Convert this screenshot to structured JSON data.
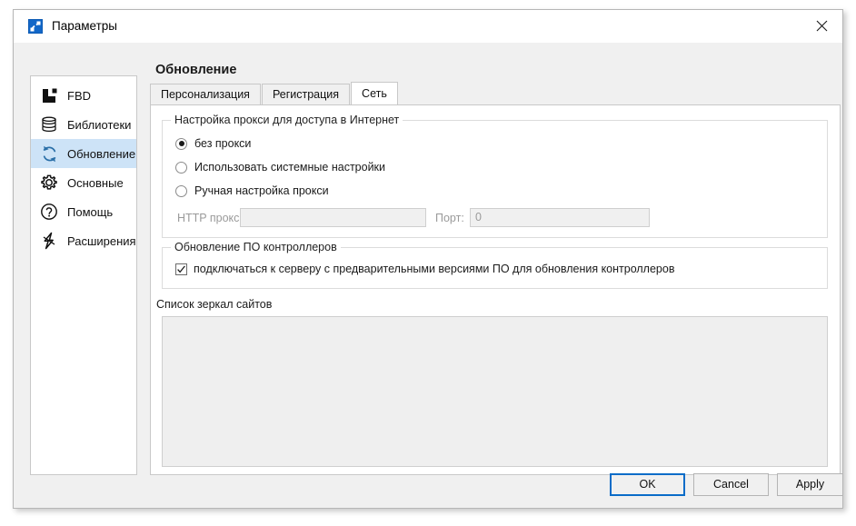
{
  "window": {
    "title": "Параметры",
    "icon": "app-icon",
    "close_icon": "close-icon"
  },
  "header": {
    "page_title": "Обновление"
  },
  "sidebar": {
    "items": [
      {
        "label": "FBD",
        "icon": "fbd-icon",
        "selected": false
      },
      {
        "label": "Библиотеки",
        "icon": "library-icon",
        "selected": false
      },
      {
        "label": "Обновление",
        "icon": "refresh-icon",
        "selected": true
      },
      {
        "label": "Основные",
        "icon": "gear-icon",
        "selected": false
      },
      {
        "label": "Помощь",
        "icon": "help-icon",
        "selected": false
      },
      {
        "label": "Расширения",
        "icon": "lightning-icon",
        "selected": false
      }
    ]
  },
  "tabs": [
    {
      "label": "Персонализация",
      "active": false
    },
    {
      "label": "Регистрация",
      "active": false
    },
    {
      "label": "Сеть",
      "active": true
    }
  ],
  "proxy_group": {
    "title": "Настройка прокси для доступа в Интернет",
    "options": [
      {
        "label": "без прокси",
        "checked": true
      },
      {
        "label": "Использовать системные настройки",
        "checked": false
      },
      {
        "label": "Ручная настройка прокси",
        "checked": false
      }
    ],
    "http_proxy_label": "HTTP прокси:",
    "http_proxy_value": "",
    "http_proxy_placeholder": "",
    "port_label": "Порт:",
    "port_value": "0"
  },
  "firmware_group": {
    "title": "Обновление ПО контроллеров",
    "checkbox_label": "подключаться к серверу с предварительными версиями ПО для обновления контроллеров",
    "checkbox_checked": true
  },
  "mirrors": {
    "label": "Список зеркал сайтов",
    "items": []
  },
  "footer": {
    "ok": "OK",
    "cancel": "Cancel",
    "apply": "Apply"
  },
  "colors": {
    "accent": "#0a6cc8",
    "selection": "#cde3f7",
    "dialog_bg": "#f0f0f0",
    "panel_bg": "#ffffff",
    "border": "#c8c8c8",
    "disabled_text": "#9a9a9a"
  }
}
